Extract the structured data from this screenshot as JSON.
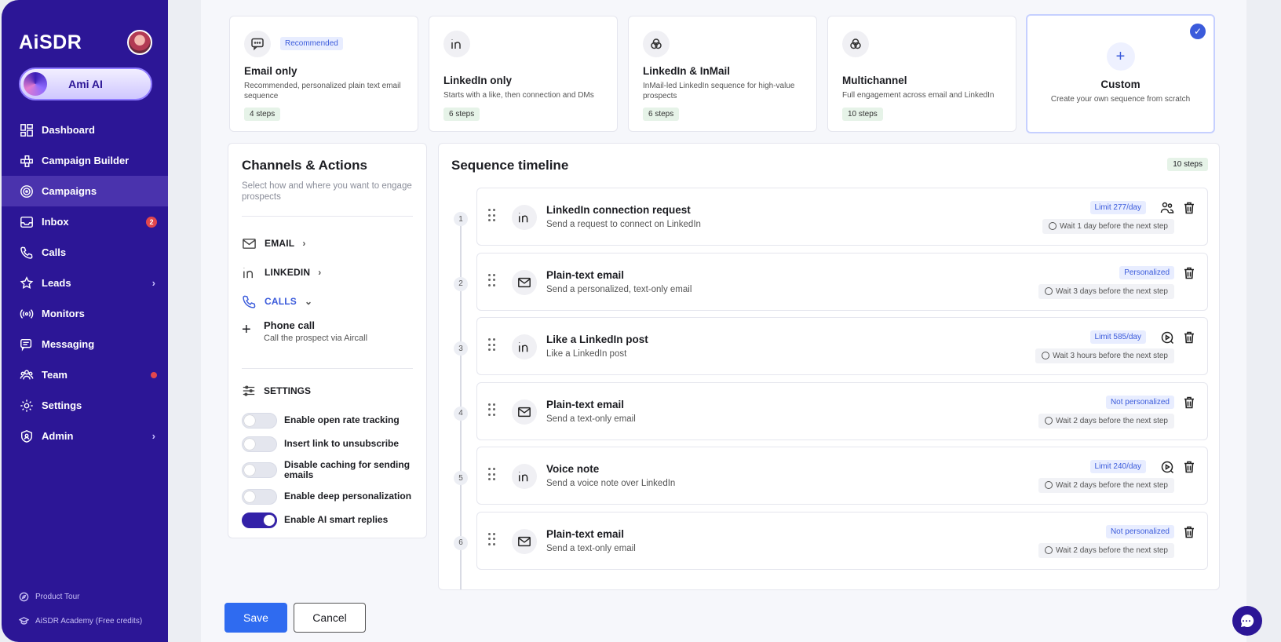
{
  "app": {
    "logo": "AiSDR",
    "agent_button": "Ami AI"
  },
  "sidebar": {
    "items": [
      {
        "label": "Dashboard",
        "icon": "dashboard-icon"
      },
      {
        "label": "Campaign Builder",
        "icon": "campaign-builder-icon"
      },
      {
        "label": "Campaigns",
        "icon": "target-icon",
        "active": true
      },
      {
        "label": "Inbox",
        "icon": "inbox-icon",
        "badge": "2"
      },
      {
        "label": "Calls",
        "icon": "phone-icon"
      },
      {
        "label": "Leads",
        "icon": "star-person-icon",
        "chevron": true
      },
      {
        "label": "Monitors",
        "icon": "broadcast-icon"
      },
      {
        "label": "Messaging",
        "icon": "messaging-icon"
      },
      {
        "label": "Team",
        "icon": "team-icon",
        "dot": true
      },
      {
        "label": "Settings",
        "icon": "gear-icon"
      },
      {
        "label": "Admin",
        "icon": "shield-icon",
        "chevron": true
      }
    ],
    "footer": {
      "tour": "Product Tour",
      "academy": "AiSDR Academy (Free credits)"
    }
  },
  "templates": [
    {
      "title": "Email only",
      "badge": "Recommended",
      "desc": "Recommended, personalized plain text email sequence",
      "steps": "4 steps",
      "icon": "chat-icon"
    },
    {
      "title": "LinkedIn only",
      "desc": "Starts with a like, then connection and DMs",
      "steps": "6 steps",
      "icon": "linkedin-icon"
    },
    {
      "title": "LinkedIn & InMail",
      "desc": "InMail-led LinkedIn sequence for high-value prospects",
      "steps": "6 steps",
      "icon": "linkedin-inmail-icon"
    },
    {
      "title": "Multichannel",
      "desc": "Full engagement across email and LinkedIn",
      "steps": "10 steps",
      "icon": "multichannel-icon"
    },
    {
      "title": "Custom",
      "desc": "Create your own sequence from scratch",
      "icon": "plus-icon",
      "selected": true
    }
  ],
  "channels": {
    "title": "Channels & Actions",
    "subtitle": "Select how and where you want to engage prospects",
    "items": [
      {
        "label": "EMAIL",
        "icon": "mail-icon"
      },
      {
        "label": "LINKEDIN",
        "icon": "linkedin-icon"
      },
      {
        "label": "CALLS",
        "icon": "phone-icon",
        "expanded": true
      }
    ],
    "phone_call": {
      "title": "Phone call",
      "desc": "Call the prospect via Aircall"
    },
    "settings_label": "SETTINGS",
    "toggles": [
      {
        "label": "Enable open rate tracking",
        "on": false
      },
      {
        "label": "Insert link to unsubscribe",
        "on": false
      },
      {
        "label": "Disable caching for sending emails",
        "on": false
      },
      {
        "label": "Enable deep personalization",
        "on": false
      },
      {
        "label": "Enable AI smart replies",
        "on": true
      }
    ]
  },
  "timeline": {
    "title": "Sequence timeline",
    "steps_count": "10 steps",
    "steps": [
      {
        "num": "1",
        "title": "LinkedIn connection request",
        "desc": "Send a request to connect on LinkedIn",
        "badge": "Limit 277/day",
        "wait": "Wait 1 day before the next step",
        "icon": "linkedin-icon",
        "extra": "people-icon"
      },
      {
        "num": "2",
        "title": "Plain-text email",
        "desc": "Send a personalized, text-only email",
        "badge": "Personalized",
        "wait": "Wait 3 days before the next step",
        "icon": "mail-icon"
      },
      {
        "num": "3",
        "title": "Like a LinkedIn post",
        "desc": "Like a LinkedIn post",
        "badge": "Limit 585/day",
        "wait": "Wait 3 hours before the next step",
        "icon": "linkedin-icon",
        "extra": "play-icon"
      },
      {
        "num": "4",
        "title": "Plain-text email",
        "desc": "Send a text-only email",
        "badge": "Not personalized",
        "wait": "Wait 2 days before the next step",
        "icon": "mail-icon"
      },
      {
        "num": "5",
        "title": "Voice note",
        "desc": "Send a voice note over LinkedIn",
        "badge": "Limit 240/day",
        "wait": "Wait 2 days before the next step",
        "icon": "linkedin-icon",
        "extra": "play-icon"
      },
      {
        "num": "6",
        "title": "Plain-text email",
        "desc": "Send a text-only email",
        "badge": "Not personalized",
        "wait": "Wait 2 days before the next step",
        "icon": "mail-icon"
      }
    ]
  },
  "footer": {
    "save": "Save",
    "cancel": "Cancel"
  }
}
